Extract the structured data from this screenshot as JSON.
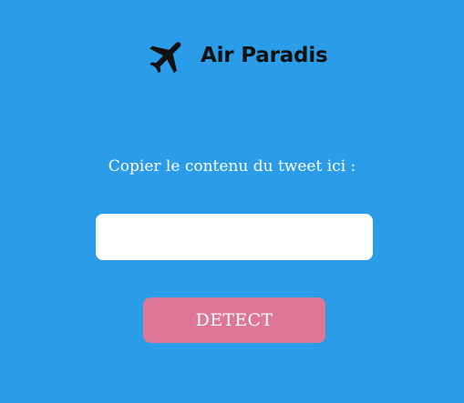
{
  "brand": {
    "icon": "airplane-icon",
    "name": "Air Paradis"
  },
  "form": {
    "prompt": "Copier le contenu du tweet ici :",
    "input_value": "",
    "input_placeholder": "",
    "button_label": "DETECT"
  },
  "colors": {
    "background": "#2b9de8",
    "button": "#de7696",
    "input": "#ffffff",
    "logo": "#111111"
  }
}
